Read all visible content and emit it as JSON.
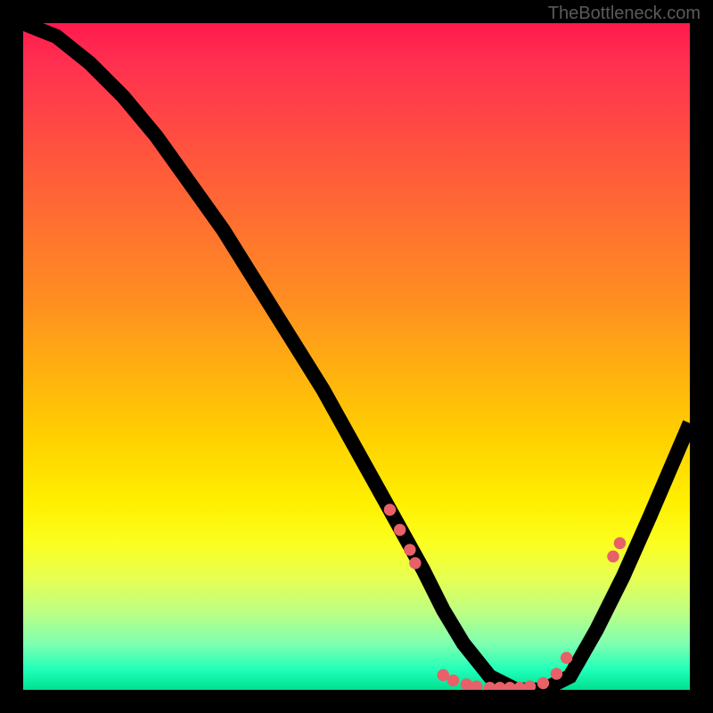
{
  "watermark": "TheBottleneck.com",
  "chart_data": {
    "type": "line",
    "title": "",
    "xlabel": "",
    "ylabel": "",
    "xlim": [
      0,
      100
    ],
    "ylim": [
      0,
      100
    ],
    "series": [
      {
        "name": "curve",
        "x": [
          0,
          5,
          10,
          15,
          20,
          25,
          30,
          35,
          40,
          45,
          50,
          55,
          60,
          63,
          66,
          70,
          74,
          78,
          82,
          86,
          90,
          94,
          97,
          100
        ],
        "y": [
          100,
          98,
          94,
          89,
          83,
          76,
          69,
          61,
          53,
          45,
          36,
          27,
          18,
          12,
          7,
          2,
          0,
          0,
          2,
          9,
          17,
          26,
          33,
          40
        ]
      }
    ],
    "points": [
      {
        "x": 55,
        "y": 27
      },
      {
        "x": 56.5,
        "y": 24
      },
      {
        "x": 58,
        "y": 21
      },
      {
        "x": 58.8,
        "y": 19
      },
      {
        "x": 63,
        "y": 2.2
      },
      {
        "x": 64.5,
        "y": 1.4
      },
      {
        "x": 66.5,
        "y": 0.8
      },
      {
        "x": 68,
        "y": 0.5
      },
      {
        "x": 70,
        "y": 0.3
      },
      {
        "x": 71.5,
        "y": 0.3
      },
      {
        "x": 73,
        "y": 0.3
      },
      {
        "x": 74.5,
        "y": 0.3
      },
      {
        "x": 76,
        "y": 0.5
      },
      {
        "x": 78,
        "y": 1.0
      },
      {
        "x": 80,
        "y": 2.4
      },
      {
        "x": 81.5,
        "y": 4.8
      },
      {
        "x": 88.5,
        "y": 20
      },
      {
        "x": 89.5,
        "y": 22
      }
    ],
    "point_color": "#e86068"
  }
}
